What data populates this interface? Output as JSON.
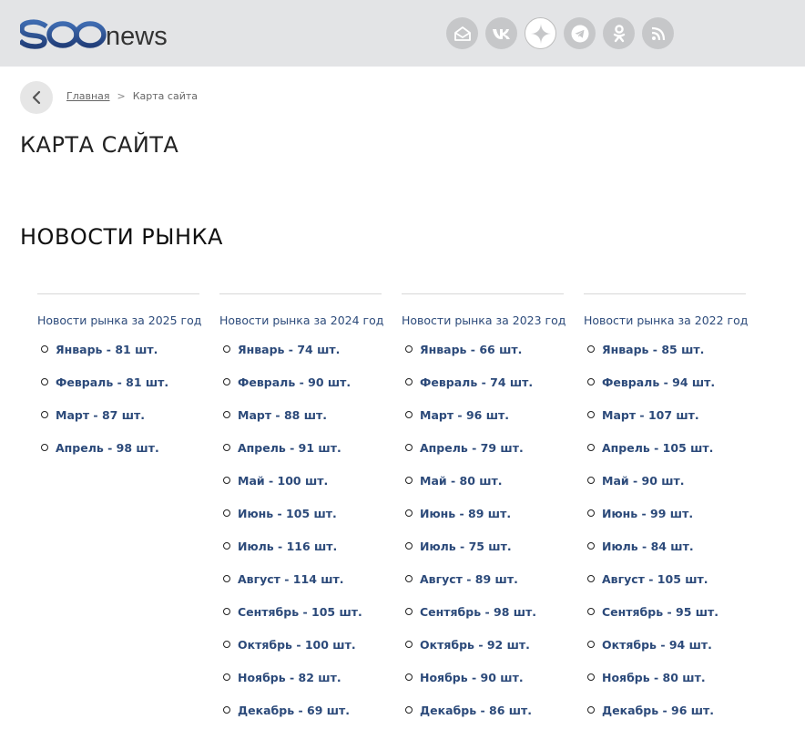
{
  "header": {
    "logo_text": "seonews",
    "social": [
      {
        "name": "email-icon"
      },
      {
        "name": "vk-icon"
      },
      {
        "name": "dzen-icon"
      },
      {
        "name": "telegram-icon"
      },
      {
        "name": "odnoklassniki-icon"
      },
      {
        "name": "rss-icon"
      }
    ]
  },
  "breadcrumb": {
    "home": "Главная",
    "separator": ">",
    "current": "Карта сайта"
  },
  "page_title": "КАРТА САЙТА",
  "section_title": "НОВОСТИ РЫНКА",
  "columns": [
    {
      "title": "Новости рынка за 2025 год",
      "months": [
        "Январь - 81 шт.",
        "Февраль - 81 шт.",
        "Март - 87 шт.",
        "Апрель - 98 шт."
      ]
    },
    {
      "title": "Новости рынка за 2024 год",
      "months": [
        "Январь - 74 шт.",
        "Февраль - 90 шт.",
        "Март - 88 шт.",
        "Апрель - 91 шт.",
        "Май - 100 шт.",
        "Июнь - 105 шт.",
        "Июль - 116 шт.",
        "Август - 114 шт.",
        "Сентябрь - 105 шт.",
        "Октябрь - 100 шт.",
        "Ноябрь - 82 шт.",
        "Декабрь - 69 шт."
      ]
    },
    {
      "title": "Новости рынка за 2023 год",
      "months": [
        "Январь - 66 шт.",
        "Февраль - 74 шт.",
        "Март - 96 шт.",
        "Апрель - 79 шт.",
        "Май - 80 шт.",
        "Июнь - 89 шт.",
        "Июль - 75 шт.",
        "Август - 89 шт.",
        "Сентябрь - 98 шт.",
        "Октябрь - 92 шт.",
        "Ноябрь - 90 шт.",
        "Декабрь - 86 шт."
      ]
    },
    {
      "title": "Новости рынка за 2022 год",
      "months": [
        "Январь - 85 шт.",
        "Февраль - 94 шт.",
        "Март - 107 шт.",
        "Апрель - 105 шт.",
        "Май - 90 шт.",
        "Июнь - 99 шт.",
        "Июль - 84 шт.",
        "Август - 105 шт.",
        "Сентябрь - 95 шт.",
        "Октябрь - 94 шт.",
        "Ноябрь - 80 шт.",
        "Декабрь - 96 шт."
      ]
    }
  ],
  "colors": {
    "header_bg": "#e3e4e6",
    "link": "#2c4a7a",
    "logo_blue": "#2b5597"
  }
}
